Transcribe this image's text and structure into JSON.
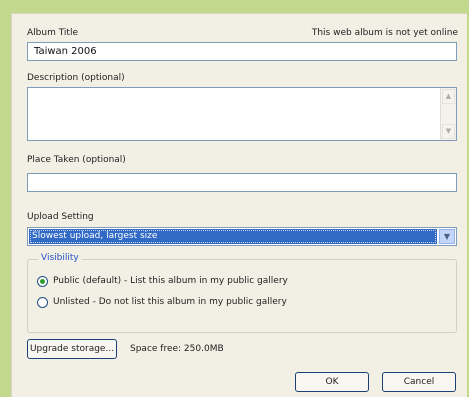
{
  "album_title": {
    "label": "Album Title",
    "value": "Taiwan 2006",
    "status": "This web album is not yet online"
  },
  "description": {
    "label": "Description (optional)",
    "value": ""
  },
  "place_taken": {
    "label": "Place Taken (optional)",
    "value": ""
  },
  "upload_setting": {
    "label": "Upload Setting",
    "selected": "Slowest upload, largest size"
  },
  "visibility": {
    "title": "Visibility",
    "options": [
      {
        "label": "Public (default) - List this album in my public gallery",
        "checked": true
      },
      {
        "label": "Unlisted - Do not list this album in my public gallery",
        "checked": false
      }
    ]
  },
  "storage": {
    "button_label": "Upgrade storage...",
    "space_free": "Space free: 250.0MB"
  },
  "actions": {
    "ok_label": "OK",
    "cancel_label": "Cancel"
  },
  "colors": {
    "background": "#c2d98d",
    "dialog": "#f2f0e5",
    "selection": "#316ac5",
    "group_title": "#2551c9"
  }
}
